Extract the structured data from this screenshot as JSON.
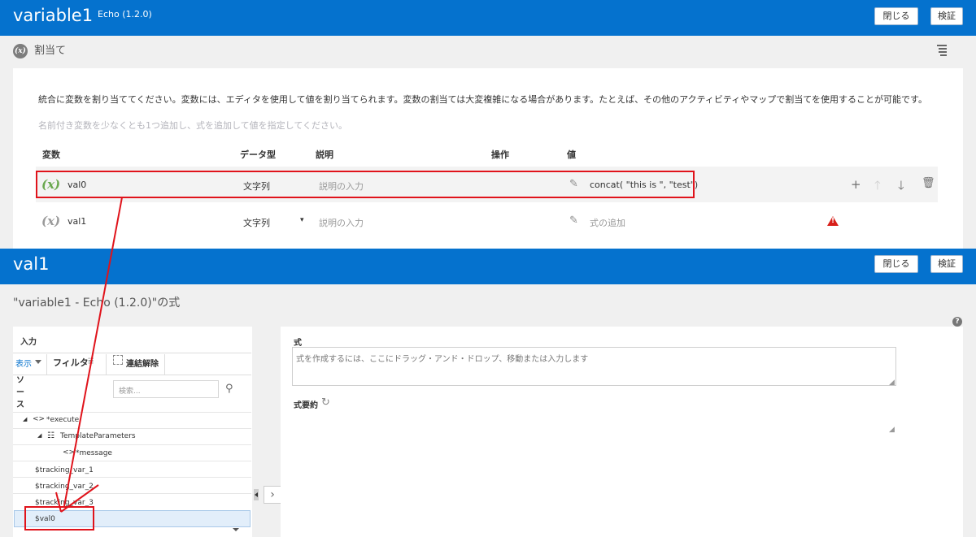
{
  "panel1": {
    "title": "variable1",
    "subtitle": "Echo (1.2.0)",
    "close_label": "閉じる",
    "validate_label": "検証",
    "assign_icon": "(x)",
    "assign_label": "割当て",
    "description": "統合に変数を割り当ててください。変数には、エディタを使用して値を割り当てられます。変数の割当ては大変複雑になる場合があります。たとえば、その他のアクティビティやマップで割当てを使用することが可能です。",
    "hint": "名前付き変数を少なくとも1つ追加し、式を追加して値を指定してください。",
    "columns": [
      "変数",
      "データ型",
      "説明",
      "操作",
      "値"
    ],
    "rows": [
      {
        "icon": "(x)",
        "name": "val0",
        "type": "文字列",
        "desc_placeholder": "説明の入力",
        "value": "concat( \"this is \", \"test\")"
      },
      {
        "icon": "(x)",
        "name": "val1",
        "type": "文字列",
        "desc_placeholder": "説明の入力",
        "value": "式の追加"
      }
    ],
    "type_caret": "▾"
  },
  "panel2": {
    "title": "val1",
    "close_label": "閉じる",
    "validate_label": "検証",
    "expr_title": "\"variable1 - Echo (1.2.0)\"の式",
    "help": "?",
    "input_label": "入力",
    "view_tab": "表示",
    "filter_tab": "フィルタ",
    "unlink_tab": "連結解除",
    "source_label": "ソース",
    "search_placeholder": "検索...",
    "tree": {
      "execute": "*execute",
      "template_params": "TemplateParameters",
      "message": "*message",
      "tracking1": "$tracking_var_1",
      "tracking2": "$tracking_var_2",
      "tracking3": "$tracking_var_3",
      "val0": "$val0",
      "node_icon": "<>"
    },
    "formula_label": "式",
    "formula_placeholder": "式を作成するには、ここにドラッグ・アンド・ドロップ、移動または入力します",
    "summary_label": "式要約"
  },
  "colors": {
    "header_blue": "#0572ce",
    "annotation_red": "#e0131b",
    "var_green": "#6aa84f",
    "warning_red": "#d8201a"
  },
  "icons": [
    "menu-icon",
    "pencil-icon",
    "plus-icon",
    "arrow-up-icon",
    "arrow-down-icon",
    "trash-icon",
    "warning-icon",
    "filter-icon",
    "unlink-icon",
    "search-icon",
    "refresh-icon",
    "help-icon",
    "chevron-right-icon"
  ]
}
